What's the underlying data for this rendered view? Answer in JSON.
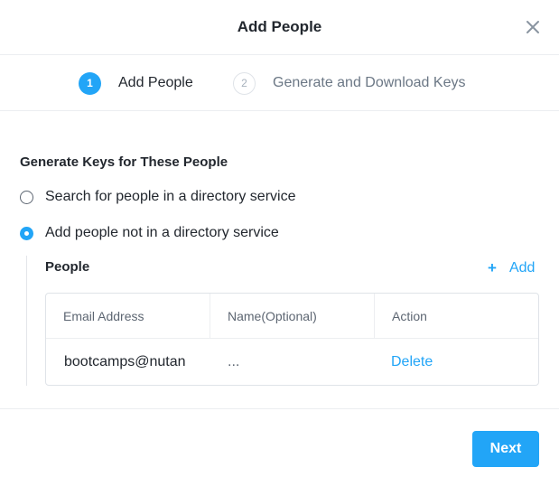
{
  "dialog": {
    "title": "Add People",
    "close_icon": "close-icon"
  },
  "steps": [
    {
      "number": "1",
      "label": "Add People",
      "active": true
    },
    {
      "number": "2",
      "label": "Generate and Download Keys",
      "active": false
    }
  ],
  "section": {
    "title": "Generate Keys for These People",
    "options": [
      {
        "label": "Search for people in a directory service",
        "checked": false
      },
      {
        "label": "Add people not in a directory service",
        "checked": true
      }
    ]
  },
  "people": {
    "label": "People",
    "add_label": "Add",
    "add_icon": "plus-icon",
    "columns": [
      "Email Address",
      "Name(Optional)",
      "Action"
    ],
    "rows": [
      {
        "email": "bootcamps@nutan",
        "name": "...",
        "action": "Delete"
      }
    ]
  },
  "footer": {
    "next_label": "Next"
  },
  "colors": {
    "accent": "#22a5f7",
    "text": "#22272e",
    "muted": "#5d6672",
    "border": "#dfe3e8"
  }
}
